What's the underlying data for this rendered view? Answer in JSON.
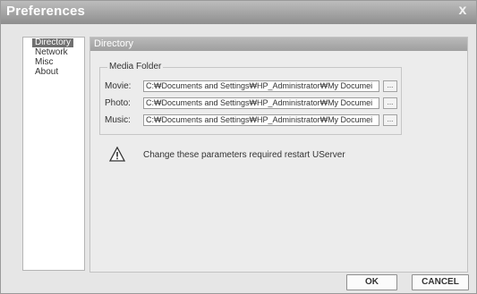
{
  "window": {
    "title": "Preferences",
    "close_glyph": "x",
    "close_icon": "close-icon"
  },
  "nav": {
    "items": [
      {
        "label": "Directory",
        "selected": true
      },
      {
        "label": "Network",
        "selected": false
      },
      {
        "label": "Misc",
        "selected": false
      },
      {
        "label": "About",
        "selected": false
      }
    ]
  },
  "panel": {
    "header": "Directory",
    "group_title": "Media Folder",
    "rows": [
      {
        "label": "Movie:",
        "value": "C:₩Documents and Settings₩HP_Administrator₩My Documei",
        "browse_label": "..."
      },
      {
        "label": "Photo:",
        "value": "C:₩Documents and Settings₩HP_Administrator₩My Documei",
        "browse_label": "..."
      },
      {
        "label": "Music:",
        "value": "C:₩Documents and Settings₩HP_Administrator₩My Documei",
        "browse_label": "..."
      }
    ],
    "warning_icon": "warning-icon",
    "warning_text": "Change these parameters required restart UServer"
  },
  "buttons": {
    "ok": "OK",
    "cancel": "CANCEL"
  },
  "colors": {
    "titlebar": "#9e9e9e",
    "selection": "#707070",
    "panel_header": "#adadad"
  }
}
